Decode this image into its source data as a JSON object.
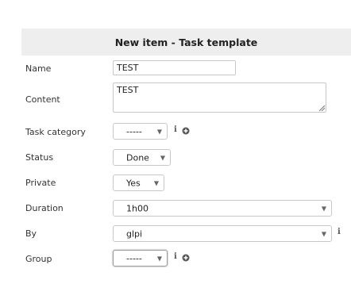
{
  "header": {
    "title": "New item - Task template"
  },
  "fields": {
    "name": {
      "label": "Name",
      "value": "TEST"
    },
    "content": {
      "label": "Content",
      "value": "TEST"
    },
    "task_category": {
      "label": "Task category",
      "value": "-----"
    },
    "status": {
      "label": "Status",
      "value": "Done"
    },
    "private": {
      "label": "Private",
      "value": "Yes"
    },
    "duration": {
      "label": "Duration",
      "value": "1h00"
    },
    "by": {
      "label": "By",
      "value": "glpi"
    },
    "group": {
      "label": "Group",
      "value": "-----"
    }
  },
  "icons": {
    "info": "info-icon",
    "add": "add-circle-icon",
    "dropdown": "chevron-down-icon"
  },
  "colors": {
    "header_bg": "#eeeeee",
    "border": "#c8c8c8"
  }
}
